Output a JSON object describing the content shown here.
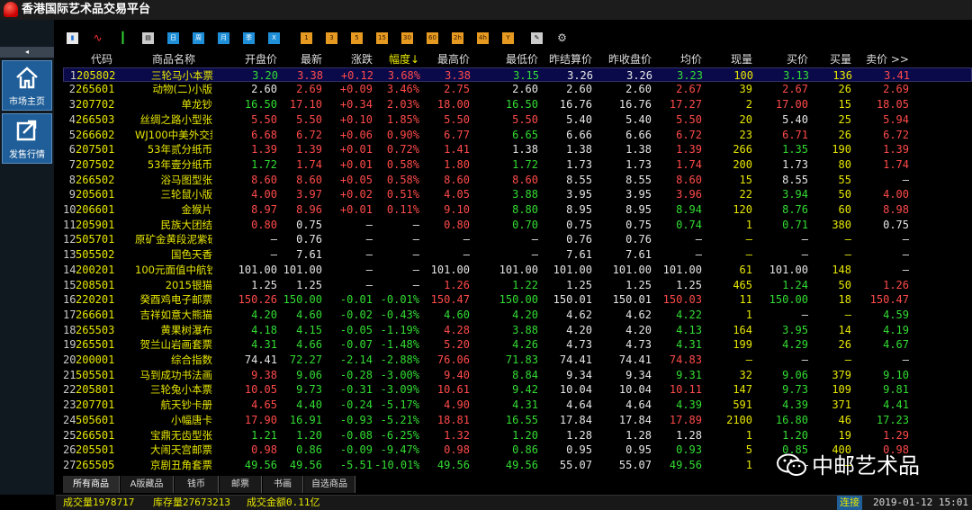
{
  "app": {
    "title": "香港国际艺术品交易平台"
  },
  "nav": {
    "market_label": "市场主页",
    "sell_label": "发售行情",
    "collapse_glyph": "◂"
  },
  "toolbar": {
    "buttons": [
      {
        "name": "bar-chart-icon",
        "glyph": "▮",
        "kind": "chart"
      },
      {
        "name": "line-chart-icon",
        "glyph": "∿",
        "kind": "line"
      },
      {
        "name": "candle-chart-icon",
        "glyph": "┃",
        "kind": "candle"
      },
      {
        "name": "table-icon",
        "glyph": "▤",
        "kind": "chart"
      },
      {
        "name": "period-day",
        "glyph": "日",
        "kind": "blue"
      },
      {
        "name": "period-week",
        "glyph": "周",
        "kind": "blue"
      },
      {
        "name": "period-month",
        "glyph": "月",
        "kind": "blue"
      },
      {
        "name": "period-season",
        "glyph": "季",
        "kind": "blue"
      },
      {
        "name": "period-year",
        "glyph": "X",
        "kind": "blue"
      },
      {
        "name": "period-1min",
        "glyph": "1",
        "kind": "orange"
      },
      {
        "name": "period-3min",
        "glyph": "3",
        "kind": "orange"
      },
      {
        "name": "period-5min",
        "glyph": "5",
        "kind": "orange"
      },
      {
        "name": "period-15min",
        "glyph": "15",
        "kind": "orange"
      },
      {
        "name": "period-30min",
        "glyph": "30",
        "kind": "orange"
      },
      {
        "name": "period-60min",
        "glyph": "60",
        "kind": "orange"
      },
      {
        "name": "period-2h",
        "glyph": "2h",
        "kind": "orange"
      },
      {
        "name": "period-4h",
        "glyph": "4h",
        "kind": "orange"
      },
      {
        "name": "period-y",
        "glyph": "Y",
        "kind": "orange"
      },
      {
        "name": "draw-icon",
        "glyph": "✎",
        "kind": "chart"
      },
      {
        "name": "settings-icon",
        "glyph": "⚙",
        "kind": "gear"
      }
    ]
  },
  "table": {
    "headers": [
      "",
      "代码",
      "商品名称",
      "开盘价",
      "最新",
      "涨跌",
      "幅度↓",
      "最高价",
      "最低价",
      "昨结算价",
      "昨收盘价",
      "均价",
      "现量",
      "买价",
      "买量",
      "卖价 >>"
    ],
    "rows": [
      [
        "1",
        "205802",
        "三轮马小本票",
        "3.20",
        "3.38",
        "+0.12",
        "3.68%",
        "3.38",
        "3.15",
        "3.26",
        "3.26",
        "3.23",
        "100",
        "3.13",
        "136",
        "3.41"
      ],
      [
        "2",
        "265601",
        "动物(二)小版",
        "2.60",
        "2.69",
        "+0.09",
        "3.46%",
        "2.75",
        "2.60",
        "2.60",
        "2.60",
        "2.67",
        "39",
        "2.67",
        "26",
        "2.69"
      ],
      [
        "3",
        "207702",
        "单龙钞",
        "16.50",
        "17.10",
        "+0.34",
        "2.03%",
        "18.00",
        "16.50",
        "16.76",
        "16.76",
        "17.27",
        "2",
        "17.00",
        "15",
        "18.05"
      ],
      [
        "4",
        "266503",
        "丝绸之路小型张",
        "5.50",
        "5.50",
        "+0.10",
        "1.85%",
        "5.50",
        "5.50",
        "5.40",
        "5.40",
        "5.50",
        "20",
        "5.40",
        "25",
        "5.94"
      ],
      [
        "5",
        "266602",
        "WJ100中美外交封",
        "6.68",
        "6.72",
        "+0.06",
        "0.90%",
        "6.77",
        "6.65",
        "6.66",
        "6.66",
        "6.72",
        "23",
        "6.71",
        "26",
        "6.72"
      ],
      [
        "6",
        "207501",
        "53年贰分纸币",
        "1.39",
        "1.39",
        "+0.01",
        "0.72%",
        "1.41",
        "1.38",
        "1.38",
        "1.38",
        "1.39",
        "266",
        "1.35",
        "190",
        "1.39"
      ],
      [
        "7",
        "207502",
        "53年壹分纸币",
        "1.72",
        "1.74",
        "+0.01",
        "0.58%",
        "1.80",
        "1.72",
        "1.73",
        "1.73",
        "1.74",
        "200",
        "1.73",
        "80",
        "1.74"
      ],
      [
        "8",
        "266502",
        "浴马图型张",
        "8.60",
        "8.60",
        "+0.05",
        "0.58%",
        "8.60",
        "8.60",
        "8.55",
        "8.55",
        "8.60",
        "15",
        "8.55",
        "55",
        "—"
      ],
      [
        "9",
        "205601",
        "三轮鼠小版",
        "4.00",
        "3.97",
        "+0.02",
        "0.51%",
        "4.05",
        "3.88",
        "3.95",
        "3.95",
        "3.96",
        "22",
        "3.94",
        "50",
        "4.00"
      ],
      [
        "10",
        "206601",
        "金猴片",
        "8.97",
        "8.96",
        "+0.01",
        "0.11%",
        "9.10",
        "8.80",
        "8.95",
        "8.95",
        "8.94",
        "120",
        "8.76",
        "60",
        "8.98"
      ],
      [
        "11",
        "205901",
        "民族大团结",
        "0.80",
        "0.75",
        "—",
        "—",
        "0.80",
        "0.70",
        "0.75",
        "0.75",
        "0.74",
        "1",
        "0.71",
        "380",
        "0.75"
      ],
      [
        "12",
        "505701",
        "原矿金黄段泥紫砂壶",
        "—",
        "0.76",
        "—",
        "—",
        "—",
        "—",
        "0.76",
        "0.76",
        "—",
        "—",
        "—",
        "—",
        "—"
      ],
      [
        "13",
        "505502",
        "国色天香",
        "—",
        "7.61",
        "—",
        "—",
        "—",
        "—",
        "7.61",
        "7.61",
        "—",
        "—",
        "—",
        "—",
        "—"
      ],
      [
        "14",
        "200201",
        "100元面值中航钞",
        "101.00",
        "101.00",
        "—",
        "—",
        "101.00",
        "101.00",
        "101.00",
        "101.00",
        "101.00",
        "61",
        "101.00",
        "148",
        "—"
      ],
      [
        "15",
        "208501",
        "2015银猫",
        "1.25",
        "1.25",
        "—",
        "—",
        "1.26",
        "1.22",
        "1.25",
        "1.25",
        "1.25",
        "465",
        "1.24",
        "50",
        "1.26"
      ],
      [
        "16",
        "220201",
        "癸酉鸡电子邮票",
        "150.26",
        "150.00",
        "-0.01",
        "-0.01%",
        "150.47",
        "150.00",
        "150.01",
        "150.01",
        "150.03",
        "11",
        "150.00",
        "18",
        "150.47"
      ],
      [
        "17",
        "266601",
        "吉祥如意大熊猫",
        "4.20",
        "4.60",
        "-0.02",
        "-0.43%",
        "4.60",
        "4.20",
        "4.62",
        "4.62",
        "4.22",
        "1",
        "—",
        "—",
        "4.59"
      ],
      [
        "18",
        "265503",
        "黄果树瀑布",
        "4.18",
        "4.15",
        "-0.05",
        "-1.19%",
        "4.28",
        "3.88",
        "4.20",
        "4.20",
        "4.13",
        "164",
        "3.95",
        "14",
        "4.19"
      ],
      [
        "19",
        "265501",
        "贺兰山岩画套票",
        "4.31",
        "4.66",
        "-0.07",
        "-1.48%",
        "5.20",
        "4.26",
        "4.73",
        "4.73",
        "4.31",
        "199",
        "4.29",
        "26",
        "4.67"
      ],
      [
        "20",
        "200001",
        "综合指数",
        "74.41",
        "72.27",
        "-2.14",
        "-2.88%",
        "76.06",
        "71.83",
        "74.41",
        "74.41",
        "74.83",
        "—",
        "—",
        "—",
        "—"
      ],
      [
        "21",
        "505501",
        "马到成功书法画",
        "9.38",
        "9.06",
        "-0.28",
        "-3.00%",
        "9.40",
        "8.84",
        "9.34",
        "9.34",
        "9.31",
        "32",
        "9.06",
        "379",
        "9.10"
      ],
      [
        "22",
        "205801",
        "三轮兔小本票",
        "10.05",
        "9.73",
        "-0.31",
        "-3.09%",
        "10.61",
        "9.42",
        "10.04",
        "10.04",
        "10.11",
        "147",
        "9.73",
        "109",
        "9.81"
      ],
      [
        "23",
        "207701",
        "航天钞卡册",
        "4.65",
        "4.40",
        "-0.24",
        "-5.17%",
        "4.90",
        "4.31",
        "4.64",
        "4.64",
        "4.39",
        "591",
        "4.39",
        "371",
        "4.41"
      ],
      [
        "24",
        "505601",
        "小幅唐卡",
        "17.90",
        "16.91",
        "-0.93",
        "-5.21%",
        "18.81",
        "16.55",
        "17.84",
        "17.84",
        "17.89",
        "2100",
        "16.80",
        "46",
        "17.23"
      ],
      [
        "25",
        "266501",
        "宝鼎无齿型张",
        "1.21",
        "1.20",
        "-0.08",
        "-6.25%",
        "1.32",
        "1.20",
        "1.28",
        "1.28",
        "1.28",
        "1",
        "1.20",
        "19",
        "1.29"
      ],
      [
        "26",
        "205501",
        "大闹天宫邮票",
        "0.98",
        "0.86",
        "-0.09",
        "-9.47%",
        "0.98",
        "0.86",
        "0.95",
        "0.95",
        "0.93",
        "5",
        "0.85",
        "400",
        "0.98"
      ],
      [
        "27",
        "265505",
        "京剧丑角套票",
        "49.56",
        "49.56",
        "-5.51",
        "-10.01%",
        "49.56",
        "49.56",
        "55.07",
        "55.07",
        "49.56",
        "1",
        "—",
        "—",
        "—"
      ]
    ]
  },
  "tabs": [
    "所有商品",
    "A版藏品",
    "钱币",
    "邮票",
    "书画",
    "自选商品"
  ],
  "status": {
    "volume": "成交量1978717",
    "stock": "库存量27673213",
    "amount": "成交金额0.11亿",
    "connection": "连接",
    "datetime": "2019-01-12 15:01"
  },
  "watermark": {
    "text": "中邮艺术品"
  },
  "colors": {
    "up": "#ff4a4a",
    "down": "#33dd33",
    "neutral": "#e6e6e6",
    "code": "#e6e600",
    "nav_blue": "#1f5e98"
  }
}
